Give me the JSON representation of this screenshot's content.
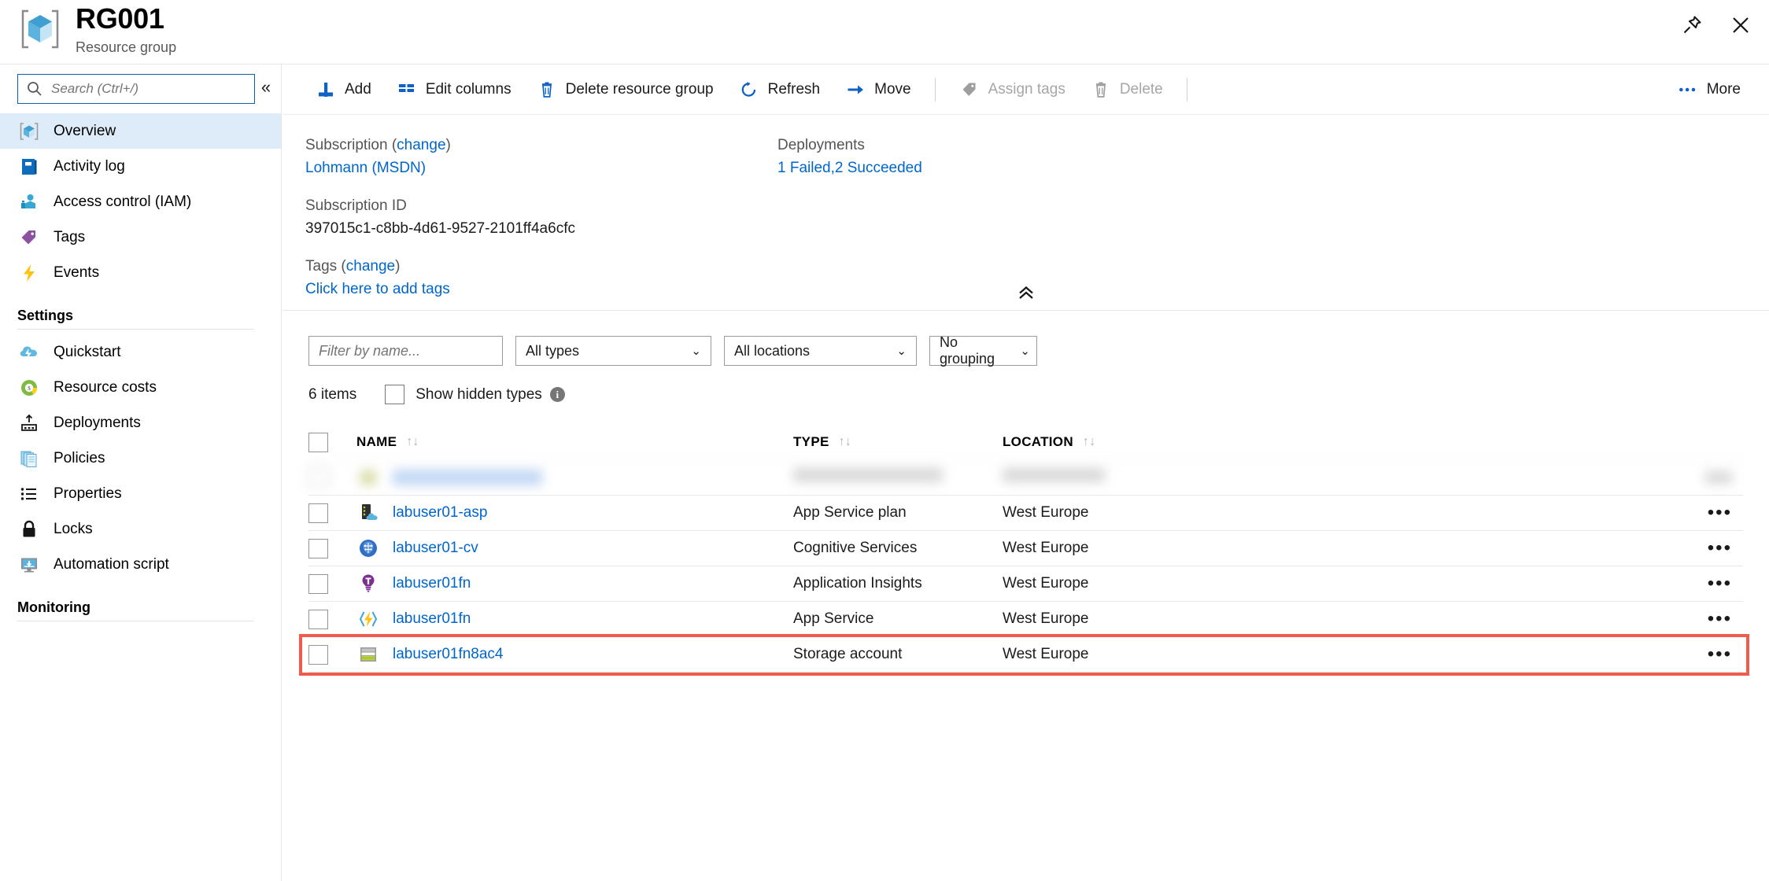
{
  "titlebar": {
    "title": "RG001",
    "subtitle": "Resource group",
    "pin_label": "Pin",
    "close_label": "Close"
  },
  "sidebar": {
    "search": {
      "placeholder": "Search (Ctrl+/)",
      "value": ""
    },
    "collapse_label": "«",
    "items": [
      {
        "label": "Overview",
        "icon": "cube-icon",
        "selected": true
      },
      {
        "label": "Activity log",
        "icon": "book-icon",
        "selected": false
      },
      {
        "label": "Access control (IAM)",
        "icon": "people-icon",
        "selected": false
      },
      {
        "label": "Tags",
        "icon": "tag-icon",
        "selected": false
      },
      {
        "label": "Events",
        "icon": "lightning-icon",
        "selected": false
      }
    ],
    "settings_header": "Settings",
    "settings_items": [
      {
        "label": "Quickstart",
        "icon": "cloud-lightning-icon"
      },
      {
        "label": "Resource costs",
        "icon": "donut-chart-icon"
      },
      {
        "label": "Deployments",
        "icon": "deploy-upload-icon"
      },
      {
        "label": "Policies",
        "icon": "documents-icon"
      },
      {
        "label": "Properties",
        "icon": "list-icon"
      },
      {
        "label": "Locks",
        "icon": "lock-icon"
      },
      {
        "label": "Automation script",
        "icon": "monitor-download-icon"
      }
    ],
    "monitoring_header": "Monitoring"
  },
  "toolbar": {
    "add": {
      "label": "Add",
      "icon": "plus-icon",
      "disabled": false
    },
    "edit_columns": {
      "label": "Edit columns",
      "icon": "columns-icon",
      "disabled": false
    },
    "delete_resource_group": {
      "label": "Delete resource group",
      "icon": "trash-icon",
      "disabled": false
    },
    "refresh": {
      "label": "Refresh",
      "icon": "refresh-icon",
      "disabled": false
    },
    "move": {
      "label": "Move",
      "icon": "arrow-right-icon",
      "disabled": false
    },
    "assign_tags": {
      "label": "Assign tags",
      "icon": "tag-icon",
      "disabled": true
    },
    "delete": {
      "label": "Delete",
      "icon": "trash-icon",
      "disabled": true
    },
    "more": {
      "label": "More",
      "icon": "ellipsis-icon"
    }
  },
  "info": {
    "subscription_label": "Subscription",
    "subscription_change": "change",
    "subscription_value": "Lohmann (MSDN)",
    "subscription_id_label": "Subscription ID",
    "subscription_id_value": "397015c1-c8bb-4d61-9527-2101ff4a6cfc",
    "tags_label": "Tags",
    "tags_change": "change",
    "tags_add_link": "Click here to add tags",
    "deployments_label": "Deployments",
    "deployments_value": "1 Failed,2 Succeeded",
    "collapse_icon": "chevron-double-up-icon"
  },
  "filters": {
    "name_placeholder": "Filter by name...",
    "name_value": "",
    "types_value": "All types",
    "locations_value": "All locations",
    "grouping_value": "No grouping"
  },
  "list": {
    "count_text": "6 items",
    "show_hidden_label": "Show hidden types",
    "show_hidden_checked": false,
    "info_glyph": "i",
    "columns": [
      {
        "label": "NAME",
        "sortable": true
      },
      {
        "label": "TYPE",
        "sortable": true
      },
      {
        "label": "LOCATION",
        "sortable": true
      }
    ],
    "sort_glyph": "↑↓",
    "rows": [
      {
        "name": "",
        "type": "",
        "location": "",
        "icon": "redacted-icon",
        "blurred": true,
        "highlighted": false
      },
      {
        "name": "labuser01-asp",
        "type": "App Service plan",
        "location": "West Europe",
        "icon": "app-service-plan-icon",
        "blurred": false,
        "highlighted": false
      },
      {
        "name": "labuser01-cv",
        "type": "Cognitive Services",
        "location": "West Europe",
        "icon": "cognitive-services-icon",
        "blurred": false,
        "highlighted": false
      },
      {
        "name": "labuser01fn",
        "type": "Application Insights",
        "location": "West Europe",
        "icon": "app-insights-icon",
        "blurred": false,
        "highlighted": false
      },
      {
        "name": "labuser01fn",
        "type": "App Service",
        "location": "West Europe",
        "icon": "app-service-icon",
        "blurred": false,
        "highlighted": false
      },
      {
        "name": "labuser01fn8ac4",
        "type": "Storage account",
        "location": "West Europe",
        "icon": "storage-account-icon",
        "blurred": false,
        "highlighted": true
      }
    ],
    "row_menu_glyph": "•••"
  },
  "colors": {
    "accent_blue": "#0066cc",
    "selected_nav": "#deecf9",
    "highlight_red": "#ef5b4c",
    "disabled_grey": "#a6a6a6"
  }
}
